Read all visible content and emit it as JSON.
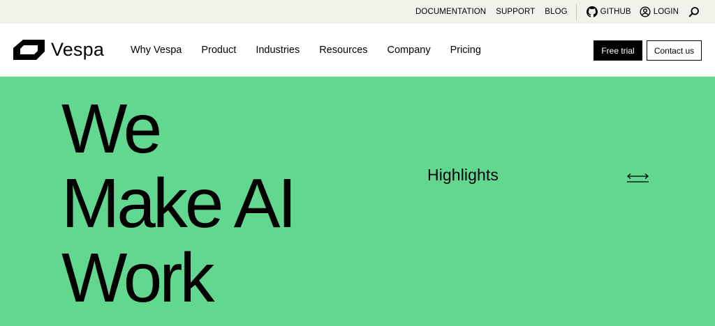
{
  "topbar": {
    "links": [
      "DOCUMENTATION",
      "SUPPORT",
      "BLOG"
    ],
    "github_label": "GITHUB",
    "login_label": "LOGIN"
  },
  "nav": {
    "logo_text": "Vespa",
    "menu": [
      "Why Vespa",
      "Product",
      "Industries",
      "Resources",
      "Company",
      "Pricing"
    ],
    "free_trial_label": "Free trial",
    "contact_label": "Contact us"
  },
  "hero": {
    "headline_lines": [
      "We",
      "Make AI",
      "Work"
    ],
    "highlights_label": "Highlights"
  },
  "colors": {
    "topbar_bg": "#f1f2ea",
    "hero_bg": "#61d790",
    "primary_button": "#000000"
  },
  "icons": {
    "logo": "vespa-logo-icon",
    "github": "github-icon",
    "login": "user-circle-icon",
    "search": "search-icon",
    "arrow": "double-arrow-icon"
  }
}
